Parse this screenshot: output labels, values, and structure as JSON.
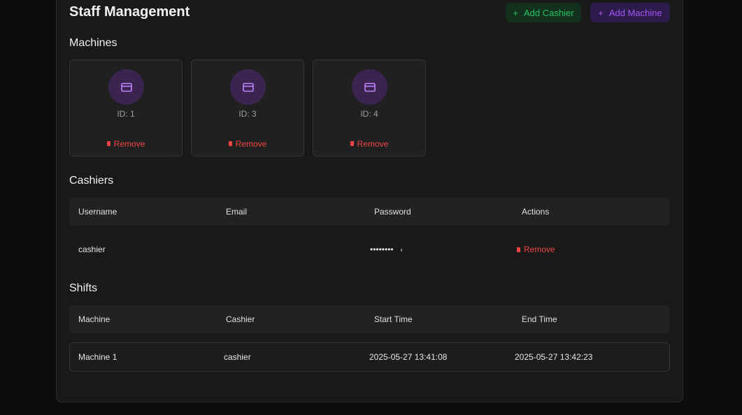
{
  "header": {
    "title": "Staff Management",
    "add_cashier_label": "Add Cashier",
    "add_machine_label": "Add Machine",
    "plus_icon": "+"
  },
  "colors": {
    "cashier_accent": "#22c55e",
    "machine_accent": "#a855f7",
    "danger": "#ef4444"
  },
  "machines": {
    "title": "Machines",
    "items": [
      {
        "id_label": "ID: 1",
        "remove_label": "Remove",
        "icon": "card-icon"
      },
      {
        "id_label": "ID: 3",
        "remove_label": "Remove",
        "icon": "card-icon"
      },
      {
        "id_label": "ID: 4",
        "remove_label": "Remove",
        "icon": "card-icon"
      }
    ]
  },
  "cashiers": {
    "title": "Cashiers",
    "columns": [
      "Username",
      "Email",
      "Password",
      "Actions"
    ],
    "rows": [
      {
        "username": "cashier",
        "email": "",
        "password": "••••••••",
        "action_label": "Remove"
      }
    ]
  },
  "shifts": {
    "title": "Shifts",
    "columns": [
      "Machine",
      "Cashier",
      "Start Time",
      "End Time"
    ],
    "rows": [
      {
        "machine": "Machine 1",
        "cashier": "cashier",
        "start": "2025-05-27 13:41:08",
        "end": "2025-05-27 13:42:23"
      }
    ]
  }
}
